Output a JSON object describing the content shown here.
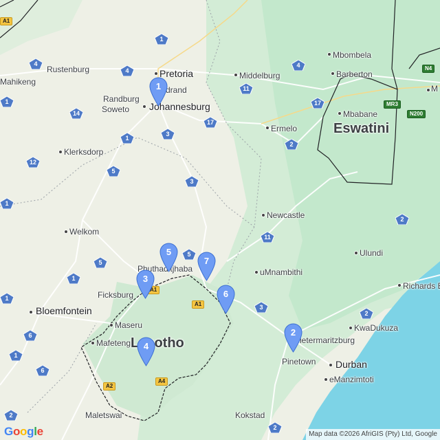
{
  "map": {
    "colors": {
      "land": "#eef0e6",
      "green": "#c8ead2",
      "ocean": "#7dd3e6",
      "road": "#ffffff",
      "border": "#202124",
      "marker": "#6f9cf4"
    },
    "cities": [
      {
        "id": "pretoria",
        "name": "Pretoria",
        "big": true
      },
      {
        "id": "johannesburg",
        "name": "Johannesburg",
        "big": true
      },
      {
        "id": "randburg",
        "name": "Randburg"
      },
      {
        "id": "soweto",
        "name": "Soweto"
      },
      {
        "id": "sandton",
        "name": "drand"
      },
      {
        "id": "rustenburg",
        "name": "Rustenburg"
      },
      {
        "id": "mahikeng",
        "name": "Mahikeng"
      },
      {
        "id": "middelburg",
        "name": "Middelburg"
      },
      {
        "id": "mbombela",
        "name": "Mbombela"
      },
      {
        "id": "barberton",
        "name": "Barberton"
      },
      {
        "id": "mbabane",
        "name": "Mbabane"
      },
      {
        "id": "ermelo",
        "name": "Ermelo"
      },
      {
        "id": "klerksdorp",
        "name": "Klerksdorp"
      },
      {
        "id": "newcastle",
        "name": "Newcastle"
      },
      {
        "id": "welkom",
        "name": "Welkom"
      },
      {
        "id": "ulundi",
        "name": "Ulundi"
      },
      {
        "id": "phuthaditjhaba",
        "name": "Phuthaditjhaba"
      },
      {
        "id": "umnambithi",
        "name": "uMnambithi"
      },
      {
        "id": "ficksburg",
        "name": "Ficksburg"
      },
      {
        "id": "richards-bay",
        "name": "Richards Ba"
      },
      {
        "id": "bloemfontein",
        "name": "Bloemfontein",
        "big": true
      },
      {
        "id": "maseru",
        "name": "Maseru"
      },
      {
        "id": "kwadukuza",
        "name": "KwaDukuza"
      },
      {
        "id": "pietermaritzburg",
        "name": "Pietermaritzburg"
      },
      {
        "id": "mafeteng",
        "name": "Mafeteng"
      },
      {
        "id": "pinetown",
        "name": "Pinetown"
      },
      {
        "id": "durban",
        "name": "Durban",
        "big": true
      },
      {
        "id": "emanzimtoti",
        "name": "eManzimtoti"
      },
      {
        "id": "kokstad",
        "name": "Kokstad"
      },
      {
        "id": "maletswai",
        "name": "Maletswai"
      },
      {
        "id": "m-edge",
        "name": "M"
      }
    ],
    "countries": [
      {
        "id": "eswatini",
        "name": "Eswatini"
      },
      {
        "id": "lesotho",
        "name": "Lesotho"
      }
    ],
    "route_shields": [
      "1",
      "4",
      "4",
      "1",
      "14",
      "3",
      "1",
      "17",
      "11",
      "4",
      "17",
      "12",
      "3",
      "2",
      "5",
      "1",
      "5",
      "11",
      "2",
      "1",
      "5",
      "1",
      "3",
      "2",
      "6",
      "6",
      "1",
      "2",
      "2"
    ],
    "rect_shields": [
      "A1",
      "N4",
      "MR3",
      "N200",
      "A1",
      "A4",
      "A2",
      "A1"
    ],
    "markers": [
      "1",
      "2",
      "3",
      "4",
      "5",
      "6",
      "7"
    ],
    "attribution": "Map data ©2026 AfriGIS (Pty) Ltd, Google",
    "logo": "Google"
  }
}
